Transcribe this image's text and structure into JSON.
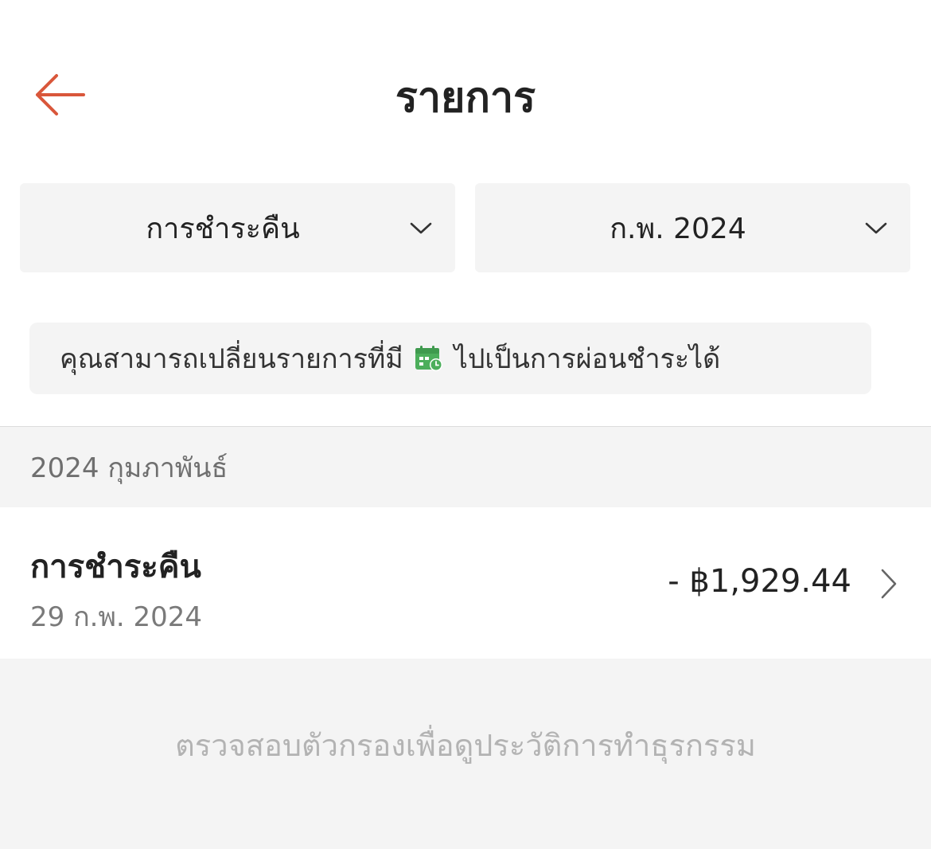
{
  "header": {
    "title": "รายการ",
    "back_icon": "arrow-left-icon"
  },
  "filters": {
    "type_label": "การชำระคืน",
    "month_label": "ก.พ. 2024"
  },
  "info_banner": {
    "text_before": "คุณสามารถเปลี่ยนรายการที่มี",
    "icon": "calendar-clock-icon",
    "text_after": "ไปเป็นการผ่อนชำระได้"
  },
  "section": {
    "month_header": "2024 กุมภาพันธ์"
  },
  "transactions": [
    {
      "name": "การชำระคืน",
      "date": "29 ก.พ. 2024",
      "amount": "- ฿1,929.44"
    }
  ],
  "footer": {
    "hint": "ตรวจสอบตัวกรองเพื่อดูประวัติการทำธุรกรรม"
  },
  "colors": {
    "accent": "#d9573b",
    "calendar_icon": "#4cae5b",
    "panel_bg": "#f4f4f4"
  }
}
